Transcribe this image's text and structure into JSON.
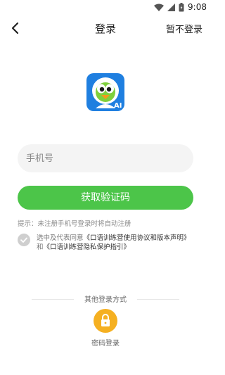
{
  "status": {
    "time": "9:08"
  },
  "header": {
    "title": "登录",
    "skip_label": "暂不登录"
  },
  "phone": {
    "placeholder": "手机号",
    "value": ""
  },
  "actions": {
    "get_code_label": "获取验证码"
  },
  "hint": "提示：未注册手机号登录时将自动注册",
  "agreement": {
    "prefix": "选中及代表同意",
    "link1": "《口语训练营使用协议和版本声明》",
    "joiner": "和",
    "link2": "《口语训练营隐私保护指引》",
    "checked": false
  },
  "other_login": {
    "label": "其他登录方式",
    "password_label": "密码登录"
  },
  "colors": {
    "primary_green": "#4cc549",
    "lock_orange": "#f5b021"
  },
  "icons": [
    "wifi-icon",
    "signal-icon",
    "battery-icon",
    "back-arrow-icon",
    "app-logo-icon",
    "check-icon",
    "lock-icon"
  ]
}
